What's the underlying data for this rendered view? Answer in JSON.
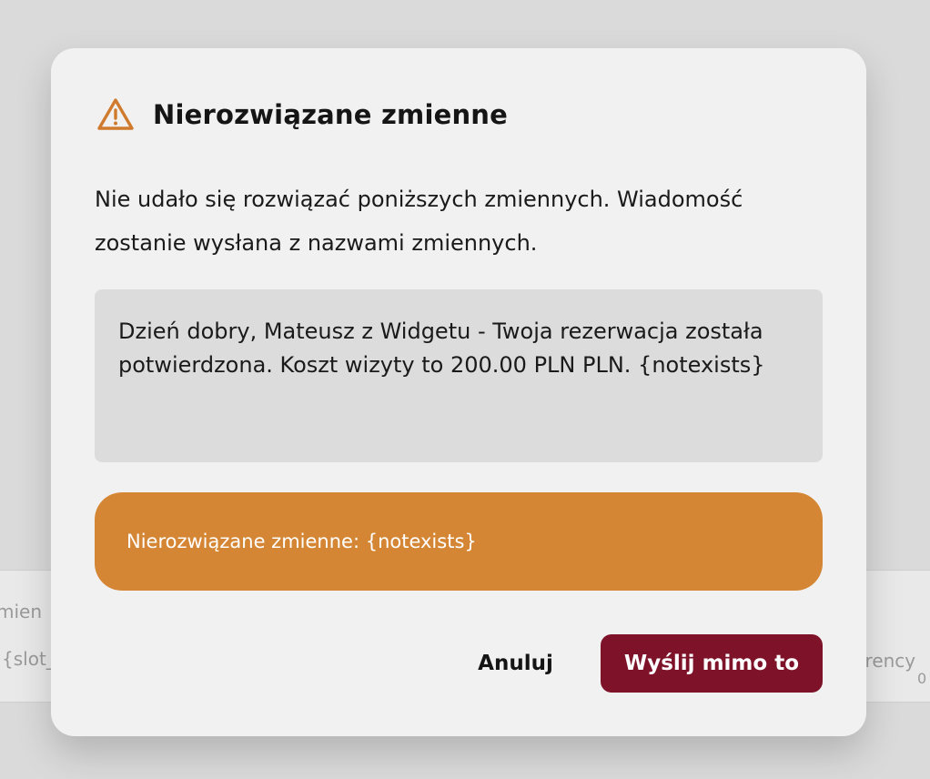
{
  "background": {
    "left_label": "mien",
    "left_chip": "{slot_",
    "right_label": "urrency",
    "right_value": "0"
  },
  "dialog": {
    "icon": "warning-triangle-icon",
    "title": "Nierozwiązane zmienne",
    "description": "Nie udało się rozwiązać poniższych zmiennych. Wiadomość zostanie wysłana z nazwami zmiennych.",
    "message_preview": "Dzień dobry, Mateusz z Widgetu - Twoja rezerwacja została potwierdzona. Koszt wizyty to 200.00 PLN PLN. {notexists}",
    "alert_text": "Nierozwiązane zmienne: {notexists}",
    "cancel_label": "Anuluj",
    "confirm_label": "Wyślij mimo to"
  },
  "colors": {
    "accent": "#7d1229",
    "warning": "#d58634",
    "icon": "#d07a2e"
  }
}
